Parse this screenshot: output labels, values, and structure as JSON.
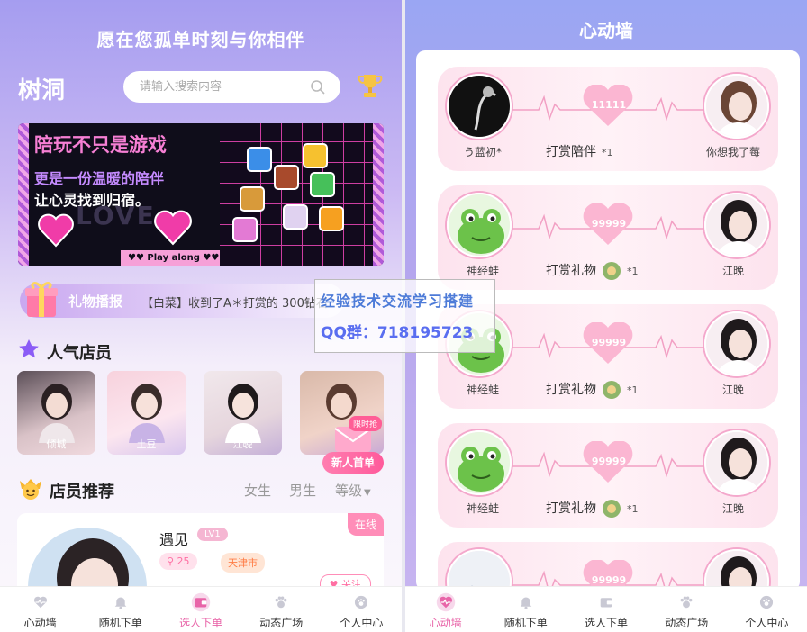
{
  "left": {
    "slogan": "愿在您孤单时刻与你相伴",
    "brand": "树洞",
    "search": {
      "placeholder": "请输入搜索内容"
    },
    "banner": {
      "title": "陪玩不只是游戏",
      "line1": "更是一份温暖的陪伴",
      "line2": "让心灵找到归宿。",
      "love": "LOVE",
      "play": "♥♥ Play along ♥♥",
      "side_text": "Play along"
    },
    "gift_broadcast": {
      "label": "礼物播报",
      "message": "【白菜】收到了A＊打赏的 300钻石"
    },
    "popular": {
      "title": "人气店员",
      "items": [
        {
          "name": "倾城"
        },
        {
          "name": "土豆"
        },
        {
          "name": "江晚"
        },
        {
          "name": ""
        }
      ],
      "promo_limit": "限时抢",
      "promo_label": "新人首单"
    },
    "recommend": {
      "title": "店员推荐",
      "filters": [
        "女生",
        "男生",
        "等级"
      ]
    },
    "card": {
      "name": "遇见",
      "level": "LV1",
      "online": "在线",
      "age": "♀ 25",
      "city": "天津市",
      "follow": "♥ 关注"
    }
  },
  "right": {
    "title": "心动墙",
    "cards": [
      {
        "left_name": "う蓝初*",
        "right_name": "你想我了莓",
        "gift": "打赏陪伴",
        "qty": "*1",
        "heart_num": "11111"
      },
      {
        "left_name": "神经蛙",
        "right_name": "江晚",
        "gift": "打赏礼物",
        "qty": "*1",
        "heart_num": "99999"
      },
      {
        "left_name": "神经蛙",
        "right_name": "江晚",
        "gift": "打赏礼物",
        "qty": "*1",
        "heart_num": "99999"
      },
      {
        "left_name": "神经蛙",
        "right_name": "江晚",
        "gift": "打赏礼物",
        "qty": "*1",
        "heart_num": "99999"
      },
      {
        "left_name": "",
        "right_name": "",
        "gift": "",
        "qty": "",
        "heart_num": "99999"
      }
    ]
  },
  "nav": [
    {
      "label": "心动墙",
      "icon": "heartbeat-icon"
    },
    {
      "label": "随机下单",
      "icon": "bell-icon"
    },
    {
      "label": "选人下单",
      "icon": "wallet-icon"
    },
    {
      "label": "动态广场",
      "icon": "paw-icon"
    },
    {
      "label": "个人中心",
      "icon": "user-paw-icon"
    }
  ],
  "left_nav_active": 2,
  "right_nav_active": 0,
  "watermark": {
    "line1": "经验技术交流学习搭建",
    "line2": "QQ群：718195723"
  },
  "colors": {
    "accent_pink": "#e864a8",
    "header_purple": "#a59df0"
  }
}
